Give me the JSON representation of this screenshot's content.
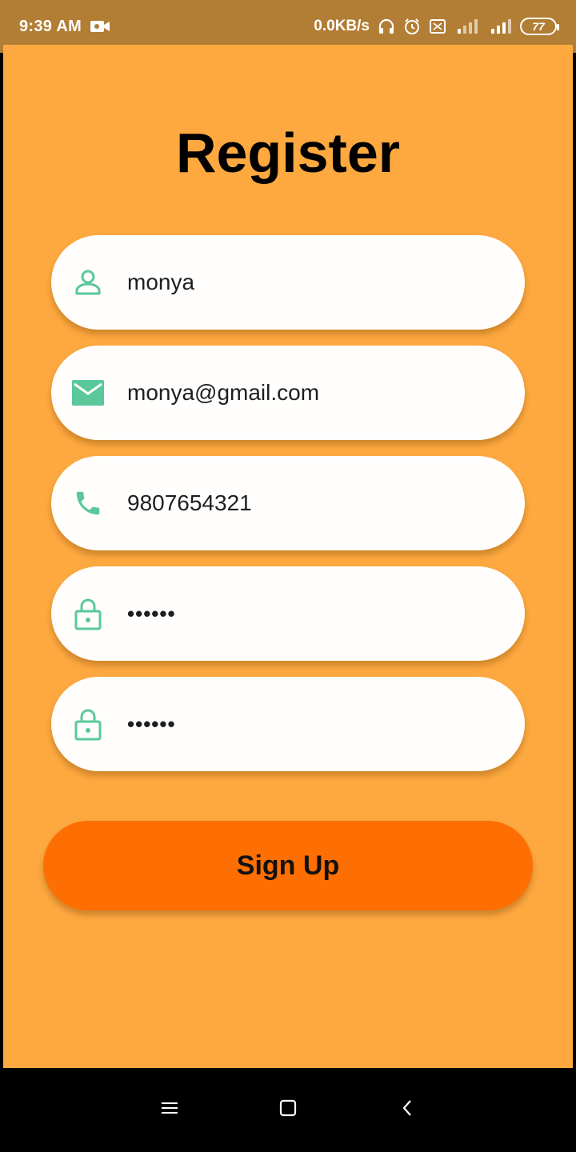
{
  "status_bar": {
    "time": "9:39 AM",
    "network_speed": "0.0KB/s",
    "battery_level": "77",
    "icons": [
      "video-recorder-icon",
      "headphones-icon",
      "alarm-icon",
      "vibrate-icon",
      "signal-1-icon",
      "signal-2-icon",
      "battery-icon"
    ]
  },
  "page": {
    "title": "Register",
    "background_color": "#fea940"
  },
  "form": {
    "fields": [
      {
        "name": "username",
        "icon": "person-icon",
        "value": "monya"
      },
      {
        "name": "email",
        "icon": "mail-icon",
        "value": "monya@gmail.com"
      },
      {
        "name": "phone",
        "icon": "phone-icon",
        "value": "9807654321"
      },
      {
        "name": "password",
        "icon": "lock-icon",
        "value": "••••••"
      },
      {
        "name": "confirm_password",
        "icon": "lock-icon",
        "value": "••••••"
      }
    ],
    "icon_color": "#5ac89a",
    "signup_label": "Sign Up",
    "signup_color": "#fd6f02"
  },
  "nav_bar": {
    "icons": [
      "menu-icon",
      "home-icon",
      "back-icon"
    ]
  }
}
